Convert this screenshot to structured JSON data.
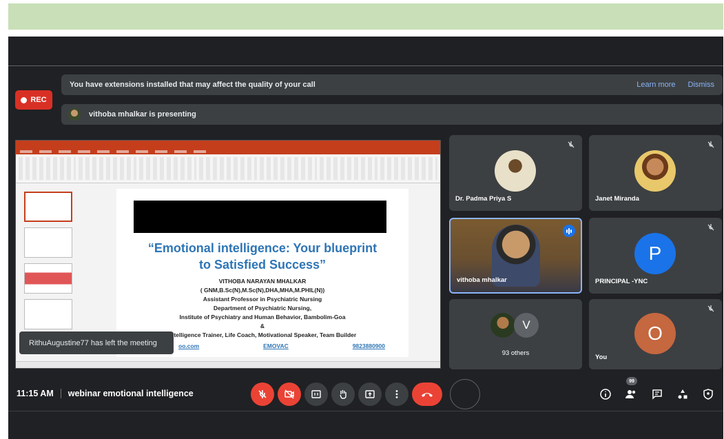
{
  "banner": {
    "message": "You have extensions installed that may affect the quality of your call",
    "learn_more": "Learn more",
    "dismiss": "Dismiss"
  },
  "rec": {
    "label": "REC"
  },
  "presenting": {
    "text": "vithoba mhalkar is presenting"
  },
  "slide": {
    "title_line1": "“Emotional intelligence: Your blueprint",
    "title_line2": "to Satisfied Success”",
    "lines": [
      "VITHOBA NARAYAN MHALKAR",
      "( GNM,B.Sc(N),M.Sc(N),DHA,MHA,M.PHIL(N))",
      "Assistant Professor in Psychiatric Nursing",
      "Department of Psychiatric Nursing,",
      "Institute of Psychiatry and Human Behavior, Bambolim-Goa",
      "&",
      "Intelligence Trainer, Life Coach, Motivational Speaker, Team Builder"
    ],
    "link1": "oo.com",
    "link2": "EMOVAC",
    "link3": "9823880900"
  },
  "toast": {
    "text": "RithuAugustine77 has left the meeting"
  },
  "participants": {
    "p1": {
      "name": "Dr. Padma Priya S"
    },
    "p2": {
      "name": "Janet Miranda"
    },
    "p3": {
      "name": "vithoba mhalkar"
    },
    "p4": {
      "name": "PRINCIPAL -YNC",
      "letter": "P",
      "color": "#1a73e8"
    },
    "p5": {
      "name": "93 others",
      "letter": "V",
      "color": "#5f6368"
    },
    "p6": {
      "name": "You",
      "letter": "O",
      "color": "#c5673f"
    }
  },
  "meeting": {
    "time": "11:15 AM",
    "title": "webinar emotional intelligence",
    "participant_count": "99"
  },
  "icons": [
    "mic-off-icon",
    "camera-off-icon",
    "captions-icon",
    "raise-hand-icon",
    "present-icon",
    "more-icon",
    "end-call-icon",
    "info-icon",
    "people-icon",
    "chat-icon",
    "activities-icon",
    "host-controls-icon"
  ],
  "colors": {
    "accent_blue": "#8ab4f8",
    "red": "#ea4335",
    "slide_title": "#2e75b6"
  }
}
